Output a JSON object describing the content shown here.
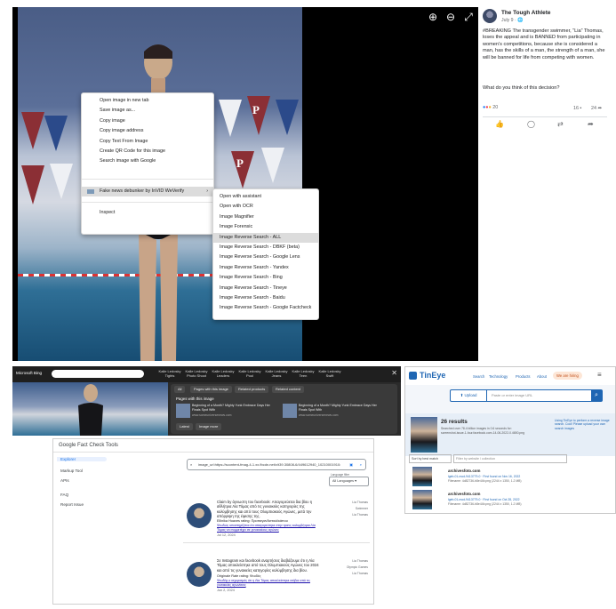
{
  "viewer": {
    "zoom_in_icon": "zoom-in-icon",
    "zoom_out_icon": "zoom-out-icon",
    "fullscreen_icon": "fullscreen-icon",
    "banner_letter": "P",
    "context_menu": {
      "items": [
        "Open image in new tab",
        "Save image as...",
        "Copy image",
        "Copy image address",
        "Copy Text From Image",
        "Create QR Code for this image",
        "Search image with Google"
      ],
      "extension_item": "Fake news debunker by InVID  WeVerify",
      "inspect": "Inspect"
    },
    "submenu": {
      "items": [
        "Open with assistant",
        "Open with OCR",
        "Image Magnifier",
        "Image Forensic",
        "Image Reverse Search - ALL",
        "Image Reverse Search - DBKF (beta)",
        "Image Reverse Search - Google Lens",
        "Image Reverse Search - Yandex",
        "Image Reverse Search - Bing",
        "Image Reverse Search - Tineye",
        "Image Reverse Search - Baidu",
        "Image Reverse Search - Google Factcheck"
      ],
      "highlighted_index": 4
    }
  },
  "post": {
    "author": "The Tough Athlete",
    "date": "July 9 · ",
    "text": "#BREAKING The transgender swimmer, “Lia” Thomas, loses the appeal and is BANNED from participating in women’s competitions, because she is considered a man, has the skills of a man, the strength of a man, she will be banned for life from competing with women.",
    "question": "What do you think of this decision?",
    "reactions_count": "20",
    "comments_count": "16",
    "shares_count": "24",
    "actions": [
      "like-icon",
      "comment-icon",
      "send-icon",
      "share-icon"
    ]
  },
  "bing": {
    "brand": "Microsoft Bing",
    "tabs": [
      "Kalle Ledosky Tights",
      "Kalle Ledosky Photo Shoot",
      "Kalle Ledosky Leaders",
      "Kalle Ledosky Pool",
      "Kalle Ledosky Jeans",
      "Kalle Ledosky Teen",
      "Kalle Ledosky Swift"
    ],
    "chips": [
      "All",
      "Pages with this image",
      "Related products",
      "Related content"
    ],
    "section_title": "Pages with this image",
    "results": [
      {
        "title": "Beginning of a Month? Mighty Yunk Embrace Days Her Finals Spot With",
        "source": "www.someuniversenews.com"
      },
      {
        "title": "Beginning of a Month? Mighty Yunk Embrace Days Her Finals Spot With",
        "source": "www.someuniversenews.com"
      }
    ],
    "pills": [
      "Latest",
      "Image more"
    ]
  },
  "tineye": {
    "logo": "TinEye",
    "nav": [
      "Search",
      "Technology",
      "Products",
      "About"
    ],
    "hiring": "We are hiring",
    "upload": "Upload",
    "placeholder": "Paste or enter image URL",
    "results_count": "26 results",
    "results_sub": "Searched over 78.4 billion images in 0.6 seconds for:",
    "filename": "screenshot-issue-1-four.facebook.com-14-06-2022-0.4650.png",
    "side_note": "Using TinEye to perform a reverse image search. Cool! Please upload your own search images",
    "sort": "Sort by best match",
    "filter": "Filter by website / collection",
    "matches": [
      {
        "site": "archivesfoto.com",
        "line1": "lgeb-01-mod-9413779-0 · First found on Nov 16, 2022",
        "line2": "Filename: 4d82736-b8e44b.png (2244 x 1350, 1.2 MB)"
      },
      {
        "site": "archivesfoto.com",
        "line1": "lgeb-01-mod-9413779-0 · First found on Oct 28, 2022",
        "line2": "Filename: 4d82736-b8e44b.png (2244 x 1350, 1.2 MB)"
      }
    ]
  },
  "factcheck": {
    "title": "Google Fact Check Tools",
    "nav": [
      "Explorer",
      "Markup Tool",
      "APIs",
      "FAQ",
      "Report Issue"
    ],
    "search_value": "image_url:https://scontent-fmag-4-1.xx.fbcdn.net/v/t39.30808-6/449612940_102100019104",
    "language_label": "Language filter",
    "language": "All Languages",
    "claims": [
      {
        "headline": "Claim by άγνωστη του facebook: Απαγορεύεται δια βίου η αθλήτρια Λία Τόμας από τις γυναικείες κατηγορίες της κολύμβησης και από τους Ολυμπιακούς Αγώνες, μετά την απόρριψη της έφεσης της.",
        "rating": "Ellinika Hoaxes rating: Προπαγανδιστικό/κάπου",
        "link": "Ψευδώς υποστηρίζεται ότι απαγορεύτηκε στην τρανς κολυμβήτρια Λία Τόμας να συμμετέχει σε γυναικείους αγώνες",
        "date": "Jul 12, 2024",
        "side": [
          "Lia Thomas",
          "Swimmer",
          "Lia Thomas"
        ]
      },
      {
        "headline": "Σε Instagram και facebook αναρτήσεις διαβάζουμε ότι η Λία Τόμας αποκλείστηκε από τους Ολυμπιακούς Αγώνες του 2024 και από τις γυναικείες κατηγορίες κολύμβησης δια βίου.",
        "rating": "Originale Rate rating: Ψευδές",
        "link": "Ψευδής ο ισχυρισμός ότι η Λία Τόμας αποκλείστηκε ισόβια από τις γυναικείες αγωνίσεις",
        "date": "Jun 2, 2024",
        "side": [
          "Lia Thomas",
          "Olympic Games",
          "Lia Thomas"
        ]
      }
    ]
  }
}
